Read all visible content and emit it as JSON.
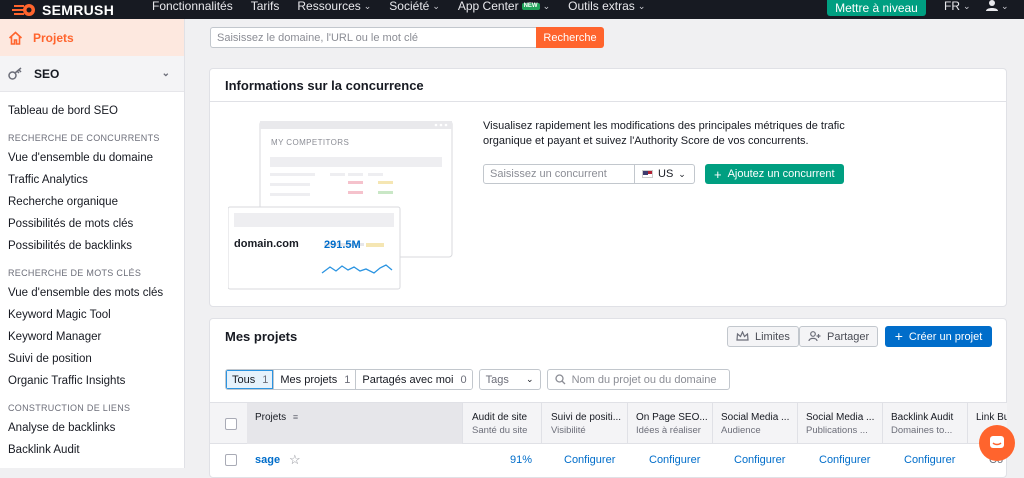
{
  "topbar": {
    "brand": "SEMRUSH",
    "nav": [
      {
        "label": "Fonctionnalités",
        "caret": false
      },
      {
        "label": "Tarifs",
        "caret": false
      },
      {
        "label": "Ressources",
        "caret": true
      },
      {
        "label": "Société",
        "caret": true
      },
      {
        "label": "App Center",
        "caret": true,
        "badge": "NEW"
      },
      {
        "label": "Outils extras",
        "caret": true
      }
    ],
    "upgrade": "Mettre à niveau",
    "lang": "FR"
  },
  "search": {
    "placeholder": "Saisissez le domaine, l'URL ou le mot clé",
    "button": "Recherche"
  },
  "sidebar": {
    "projects": "Projets",
    "seo": "SEO",
    "dashboard": "Tableau de bord SEO",
    "sections": [
      {
        "heading": "RECHERCHE DE CONCURRENTS",
        "items": [
          "Vue d'ensemble du domaine",
          "Traffic Analytics",
          "Recherche organique",
          "Possibilités de mots clés",
          "Possibilités de backlinks"
        ]
      },
      {
        "heading": "RECHERCHE DE MOTS CLÉS",
        "items": [
          "Vue d'ensemble des mots clés",
          "Keyword Magic Tool",
          "Keyword Manager",
          "Suivi de position",
          "Organic Traffic Insights"
        ]
      },
      {
        "heading": "CONSTRUCTION DE LIENS",
        "items": [
          "Analyse de backlinks",
          "Backlink Audit"
        ]
      }
    ]
  },
  "competition": {
    "title": "Informations sur la concurrence",
    "description": "Visualisez rapidement les modifications des principales métriques de trafic organique et payant et suivez l'Authority Score de vos concurrents.",
    "input_placeholder": "Saisissez un concurrent",
    "country": "US",
    "add_button": "Ajoutez un concurrent",
    "illustration": {
      "header": "MY COMPETITORS",
      "domain": "domain.com",
      "value": "291.5M"
    }
  },
  "projects": {
    "title": "Mes projets",
    "limits": "Limites",
    "share": "Partager",
    "create": "Créer un projet",
    "filters": [
      {
        "label": "Tous",
        "count": "1"
      },
      {
        "label": "Mes projets",
        "count": "1"
      },
      {
        "label": "Partagés avec moi",
        "count": "0"
      }
    ],
    "tags": "Tags",
    "search_placeholder": "Nom du projet ou du domaine",
    "columns": [
      {
        "title": "Projets",
        "sub": ""
      },
      {
        "title": "Audit de site",
        "sub": "Santé du site"
      },
      {
        "title": "Suivi de positi...",
        "sub": "Visibilité"
      },
      {
        "title": "On Page SEO...",
        "sub": "Idées à réaliser"
      },
      {
        "title": "Social Media ...",
        "sub": "Audience"
      },
      {
        "title": "Social Media ...",
        "sub": "Publications ..."
      },
      {
        "title": "Backlink Audit",
        "sub": "Domaines to..."
      },
      {
        "title": "Link Bu",
        "sub": ""
      }
    ],
    "row": {
      "name": "sage",
      "audit": "91%",
      "configure": "Configurer",
      "partial": "Co"
    }
  }
}
